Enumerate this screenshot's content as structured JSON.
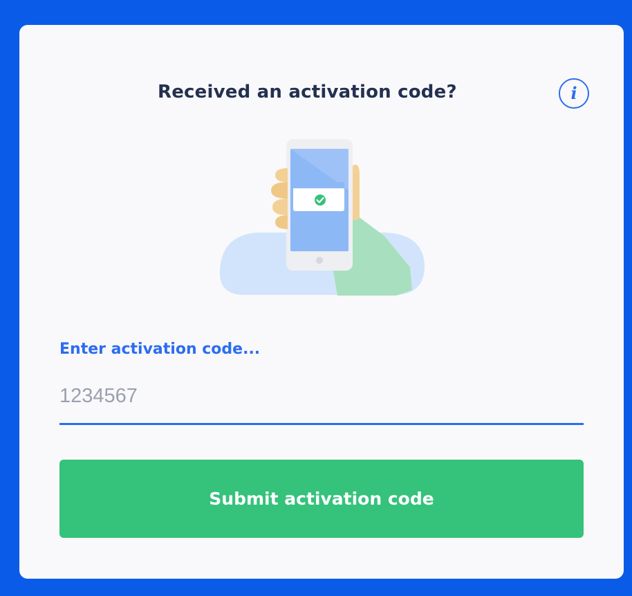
{
  "header": {
    "title": "Received an activation code?",
    "info_icon_glyph": "i",
    "info_icon": "info-icon"
  },
  "illustration": {
    "icon": "hand-holding-phone-with-checkmark-illustration"
  },
  "form": {
    "label": "Enter activation code...",
    "code_value": "1234567",
    "submit_label": "Submit activation code"
  },
  "colors": {
    "background": "#0a5ce8",
    "card": "#f9f9fb",
    "accent_blue": "#2c6df0",
    "title": "#24304f",
    "submit_button": "#35c27b",
    "input_text": "#9aa0ad"
  }
}
